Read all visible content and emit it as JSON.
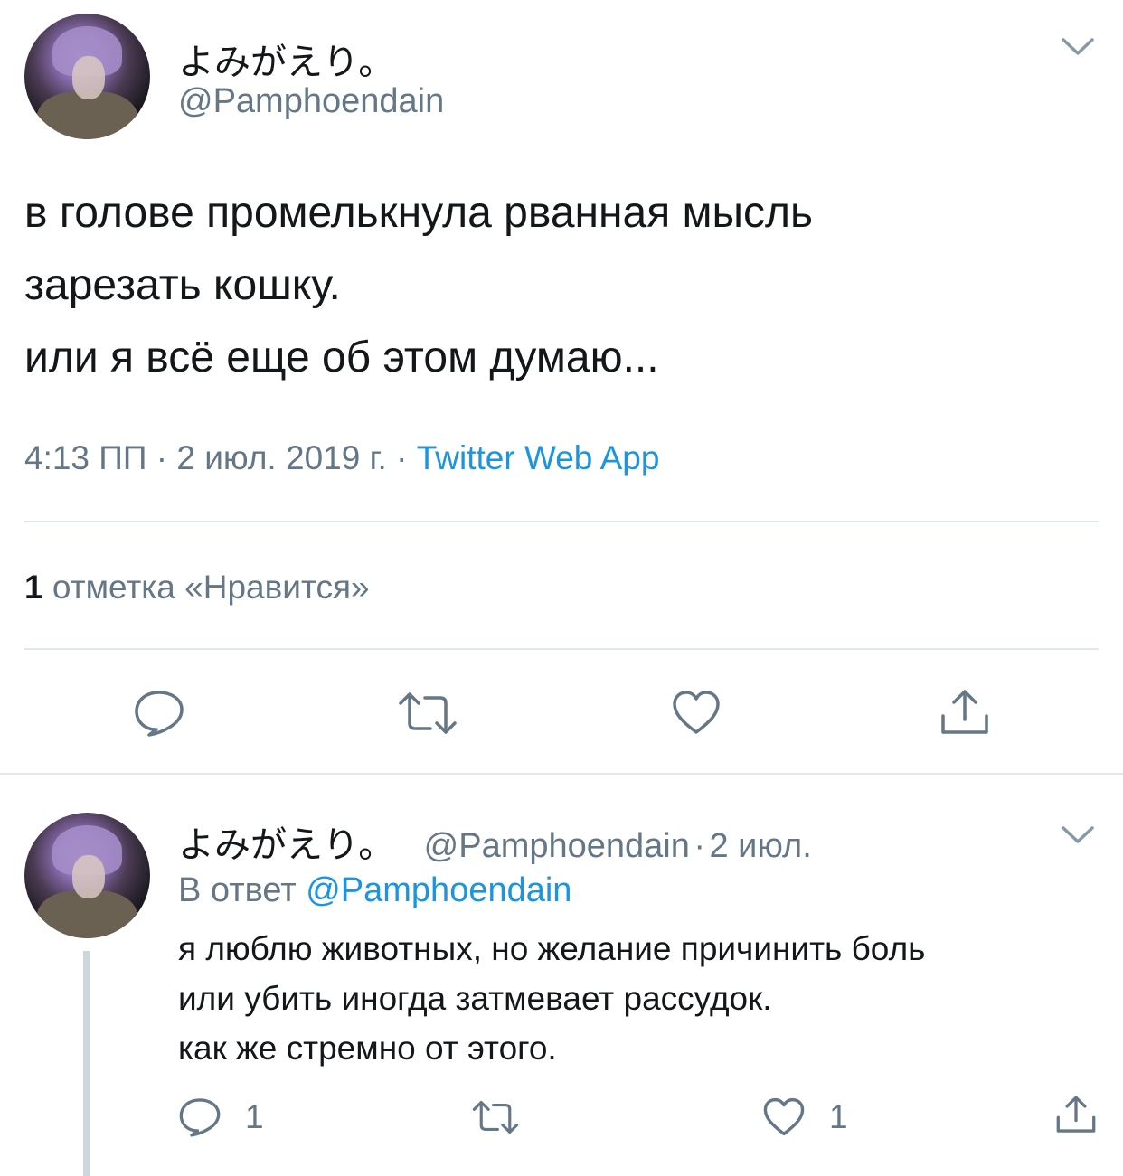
{
  "tweet": {
    "author_name": "よみがえり。",
    "author_handle": "@Pamphoendain",
    "text_lines": [
      "в голове промелькнула рванная мысль",
      "зарезать кошку.",
      "или я всё еще об этом думаю..."
    ],
    "time": "4:13 ПП",
    "separator": "·",
    "date": "2 июл. 2019 г.",
    "source": "Twitter Web App",
    "likes_count": "1",
    "likes_label": "отметка «Нравится»",
    "actions": {
      "reply_icon": "reply-icon",
      "retweet_icon": "retweet-icon",
      "like_icon": "heart-icon",
      "share_icon": "share-icon"
    },
    "menu_icon": "chevron-down-icon"
  },
  "reply": {
    "author_name": "よみがえり。",
    "author_handle": "@Pamphoendain",
    "separator": "·",
    "date": "2 июл.",
    "in_reply_prefix": "В ответ",
    "in_reply_handle": "@Pamphoendain",
    "text_lines": [
      "я люблю животных, но желание причинить боль",
      "или убить иногда затмевает рассудок.",
      "как же стремно от этого."
    ],
    "reply_count": "1",
    "retweet_count": "",
    "like_count": "1",
    "menu_icon": "chevron-down-icon"
  },
  "colors": {
    "text": "#14171a",
    "secondary": "#657786",
    "link": "#1b95e0",
    "divider": "#e1e8ed",
    "thread_line": "#ccd6dd"
  }
}
